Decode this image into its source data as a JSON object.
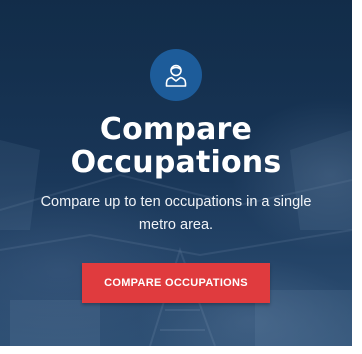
{
  "card": {
    "icon": "person-icon",
    "title_line1": "Compare",
    "title_line2": "Occupations",
    "description": "Compare up to ten occupations in a single metro area.",
    "button_label": "COMPARE OCCUPATIONS"
  },
  "colors": {
    "card_background": "#1d3a5c",
    "icon_badge": "#1d5c9a",
    "button": "#e03b3e",
    "text": "#ffffff"
  }
}
